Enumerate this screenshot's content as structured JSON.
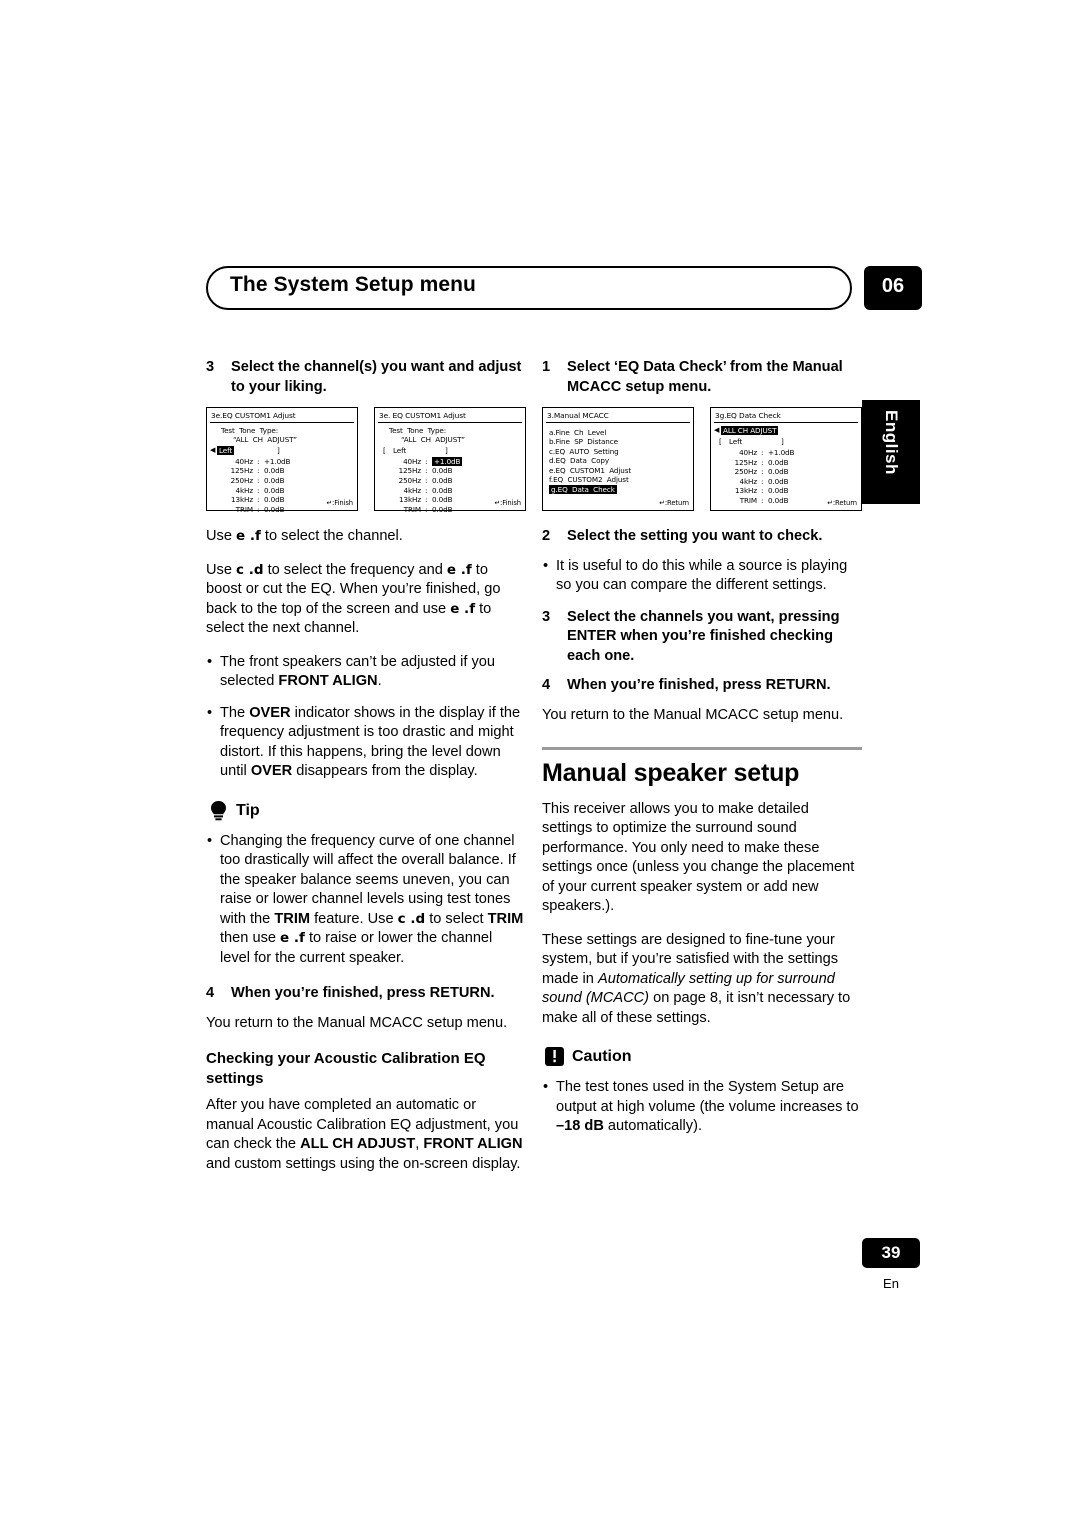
{
  "header": {
    "title": "The System Setup menu",
    "chapter": "06",
    "side_tab": "English"
  },
  "footer": {
    "page_number": "39",
    "language_code": "En"
  },
  "left_column": {
    "step3": {
      "num": "3",
      "text": "Select the channel(s) you want and adjust to your liking."
    },
    "osd1": {
      "title": "3e.EQ  CUSTOM1  Adjust",
      "line1": "Test  Tone  Type:",
      "line2": "“ALL  CH  ADJUST”",
      "channel": "Left",
      "rows": [
        {
          "freq": "40Hz",
          "sep": ":",
          "val": "+1.0dB"
        },
        {
          "freq": "125Hz",
          "sep": ":",
          "val": "0.0dB"
        },
        {
          "freq": "250Hz",
          "sep": ":",
          "val": "0.0dB"
        },
        {
          "freq": "4kHz",
          "sep": ":",
          "val": "0.0dB"
        },
        {
          "freq": "13kHz",
          "sep": ":",
          "val": "0.0dB"
        },
        {
          "freq": "TRIM",
          "sep": ":",
          "val": "0.0dB"
        }
      ],
      "foot": "↵:Finish"
    },
    "osd2": {
      "title": "3e. EQ  CUSTOM1  Adjust",
      "line1": "Test  Tone  Type:",
      "line2": "“ALL  CH  ADJUST”",
      "channel": "Left",
      "rows": [
        {
          "freq": "40Hz",
          "sep": ":",
          "val": "+1.0dB"
        },
        {
          "freq": "125Hz",
          "sep": ":",
          "val": "0.0dB"
        },
        {
          "freq": "250Hz",
          "sep": ":",
          "val": "0.0dB"
        },
        {
          "freq": "4kHz",
          "sep": ":",
          "val": "0.0dB"
        },
        {
          "freq": "13kHz",
          "sep": ":",
          "val": "0.0dB"
        },
        {
          "freq": "TRIM",
          "sep": ":",
          "val": "0.0dB"
        }
      ],
      "foot": "↵:Finish"
    },
    "para1_a": "Use ",
    "para1_keys": "e .f",
    "para1_b": " to select the channel.",
    "para2_a": "Use ",
    "para2_keys1": "c .d",
    "para2_b": " to select the frequency and ",
    "para2_keys2": "e .f",
    "para2_c": " to boost or cut the EQ. When you’re finished, go back to the top of the screen and use ",
    "para2_keys3": "e .f",
    "para2_d": " to select the next channel.",
    "bullet1_a": "The front speakers can’t be adjusted if you selected ",
    "bullet1_b": "FRONT ALIGN",
    "bullet1_c": ".",
    "bullet2_a": "The ",
    "bullet2_b": "OVER",
    "bullet2_c": " indicator shows in the display if the frequency adjustment is too drastic and might distort. If this happens, bring the level down until ",
    "bullet2_d": "OVER",
    "bullet2_e": " disappears from the display.",
    "tip_label": "Tip",
    "tip_bullet_a": "Changing the frequency curve of one channel too drastically will affect the overall balance. If the speaker balance seems uneven, you can raise or lower channel levels using test tones with the ",
    "tip_bullet_b": "TRIM",
    "tip_bullet_c": " feature. Use ",
    "tip_bullet_keys1": "c .d",
    "tip_bullet_d": " to select ",
    "tip_bullet_e": "TRIM",
    "tip_bullet_f": " then use ",
    "tip_bullet_keys2": "e .f",
    "tip_bullet_g": " to raise or lower the channel level for the current speaker.",
    "step4": {
      "num": "4",
      "text": "When you’re finished, press RETURN."
    },
    "step4_body": "You return to the Manual MCACC setup menu.",
    "subhead": "Checking your Acoustic Calibration EQ settings",
    "para3_a": "After you have completed an automatic or manual Acoustic Calibration EQ adjustment, you can check the ",
    "para3_b": "ALL CH ADJUST",
    "para3_c": ", ",
    "para3_d": "FRONT ALIGN",
    "para3_e": " and custom settings using the on-screen display."
  },
  "right_column": {
    "step1": {
      "num": "1",
      "text": "Select ‘EQ Data Check’ from the Manual MCACC setup menu."
    },
    "osd3": {
      "title": "3.Manual  MCACC",
      "rows": [
        "a.Fine  Ch  Level",
        "b.Fine  SP  Distance",
        "c.EQ  AUTO  Setting",
        "d.EQ  Data  Copy",
        "e.EQ  CUSTOM1  Adjust",
        "f.EQ  CUSTOM2  Adjust"
      ],
      "highlight": "g.EQ  Data  Check",
      "foot": "↵:Return"
    },
    "osd4": {
      "title": "3g.EQ  Data  Check",
      "mode": "ALL  CH  ADJUST",
      "channel": "Left",
      "rows": [
        {
          "freq": "40Hz",
          "sep": ":",
          "val": "+1.0dB"
        },
        {
          "freq": "125Hz",
          "sep": ":",
          "val": "0.0dB"
        },
        {
          "freq": "250Hz",
          "sep": ":",
          "val": "0.0dB"
        },
        {
          "freq": "4kHz",
          "sep": ":",
          "val": "0.0dB"
        },
        {
          "freq": "13kHz",
          "sep": ":",
          "val": "0.0dB"
        },
        {
          "freq": "TRIM",
          "sep": ":",
          "val": "0.0dB"
        }
      ],
      "foot": "↵:Return"
    },
    "step2": {
      "num": "2",
      "text": "Select the setting you want to check."
    },
    "step2_bullet": "It is useful to do this while a source is playing so you can compare the different settings.",
    "step3": {
      "num": "3",
      "text": "Select the channels you want, pressing ENTER when you’re finished checking each one."
    },
    "step4": {
      "num": "4",
      "text": "When you’re finished, press RETURN."
    },
    "step4_body": "You return to the Manual MCACC setup menu.",
    "section_title": "Manual speaker setup",
    "para1": "This receiver allows you to make detailed settings to optimize the surround sound performance. You only need to make these settings once (unless you change the placement of your current speaker system or add new speakers.).",
    "para2_a": "These settings are designed to fine-tune your system, but if you’re satisfied with the settings made in ",
    "para2_i1": "Automatically setting up for surround sound (MCACC)",
    "para2_b": " on page 8, it isn’t necessary to make all of these settings.",
    "caution_label": "Caution",
    "caution_bullet_a": "The test tones used in the System Setup are output at high volume (the volume increases to ",
    "caution_bullet_b": "–18 dB",
    "caution_bullet_c": " automatically)."
  }
}
